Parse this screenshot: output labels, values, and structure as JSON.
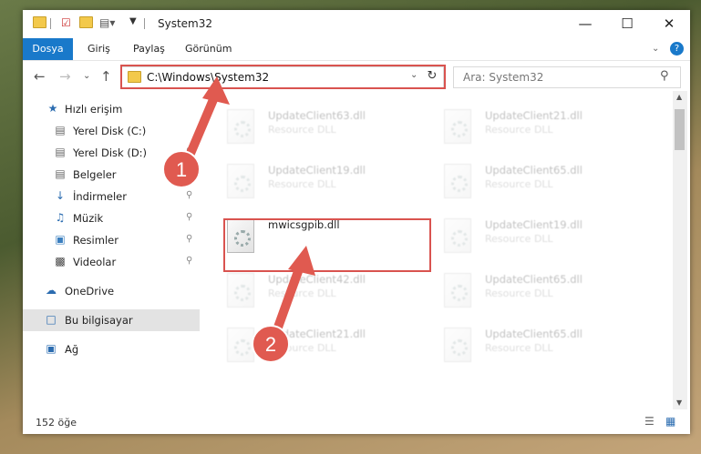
{
  "window": {
    "title": "System32"
  },
  "ribbon": {
    "tabs": [
      "Dosya",
      "Giriş",
      "Paylaş",
      "Görünüm"
    ]
  },
  "address": {
    "path": "C:\\Windows\\System32",
    "search_placeholder": "Ara: System32"
  },
  "nav": {
    "items": [
      {
        "label": "Hızlı erişim",
        "icon": "star-icon"
      },
      {
        "label": "Yerel Disk (C:)",
        "icon": "drive-icon"
      },
      {
        "label": "Yerel Disk (D:)",
        "icon": "drive-icon"
      },
      {
        "label": "Belgeler",
        "icon": "document-icon"
      },
      {
        "label": "İndirmeler",
        "icon": "download-icon"
      },
      {
        "label": "Müzik",
        "icon": "music-icon"
      },
      {
        "label": "Resimler",
        "icon": "pictures-icon"
      },
      {
        "label": "Videolar",
        "icon": "video-icon"
      },
      {
        "label": "OneDrive",
        "icon": "cloud-icon"
      },
      {
        "label": "Bu bilgisayar",
        "icon": "computer-icon"
      },
      {
        "label": "Ağ",
        "icon": "network-icon"
      }
    ]
  },
  "files": {
    "left": [
      {
        "name": "UpdateClient63.dll",
        "desc": "Resource DLL"
      },
      {
        "name": "UpdateClient19.dll",
        "desc": "Resource DLL"
      },
      {
        "name": "mwicsgpib.dll",
        "desc": ""
      },
      {
        "name": "UpdateClient42.dll",
        "desc": "Resource DLL"
      },
      {
        "name": "UpdateClient21.dll",
        "desc": "Resource DLL"
      }
    ],
    "right": [
      {
        "name": "UpdateClient21.dll",
        "desc": "Resource DLL"
      },
      {
        "name": "UpdateClient65.dll",
        "desc": "Resource DLL"
      },
      {
        "name": "UpdateClient19.dll",
        "desc": "Resource DLL"
      },
      {
        "name": "UpdateClient65.dll",
        "desc": "Resource DLL"
      },
      {
        "name": "UpdateClient65.dll",
        "desc": "Resource DLL"
      }
    ]
  },
  "status": {
    "count": "152 öğe"
  },
  "annotations": {
    "step1": "1",
    "step2": "2"
  },
  "colors": {
    "accent": "#1979ca",
    "highlight": "#d9534f"
  }
}
